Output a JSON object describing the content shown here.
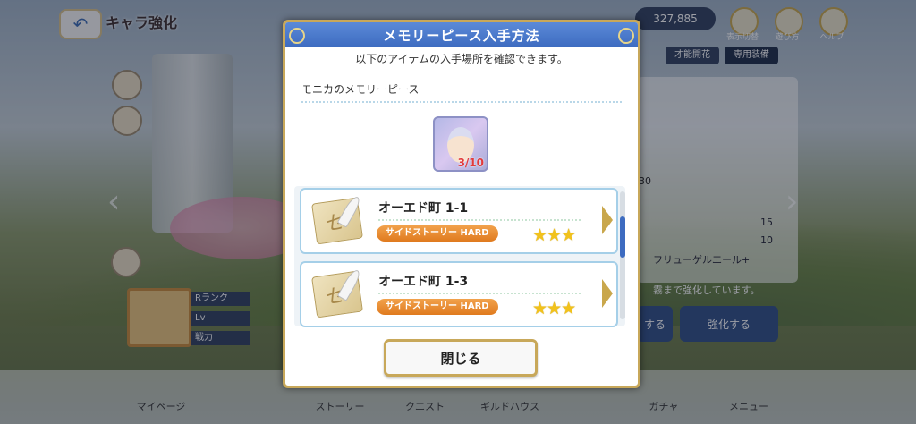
{
  "background": {
    "screen_title": "キャラ強化",
    "mana": "327,885",
    "top_icons": [
      "表示切替",
      "遊び方",
      "ヘルプ"
    ],
    "tabs": [
      "才能開花",
      "専用装備"
    ],
    "stats": [
      {
        "label": "",
        "value": "15"
      },
      {
        "label": "",
        "value": "10"
      },
      {
        "label": "フリューゲルエール+",
        "value": ""
      }
    ],
    "notice": "霧まで強化しています。",
    "side_buttons": [
      "する",
      "強化する"
    ],
    "piece_count_bg": "30",
    "char_labels": [
      "Rランク",
      "Lv",
      "戦力"
    ],
    "nav": [
      "マイページ",
      "ストーリー",
      "クエスト",
      "ギルドハウス",
      "ガチャ",
      "メニュー"
    ]
  },
  "modal": {
    "title": "メモリーピース入手方法",
    "description": "以下のアイテムの入手場所を確認できます。",
    "piece_name": "モニカのメモリーピース",
    "piece_count": "3/10",
    "quests": [
      {
        "name": "オーエド町 1-1",
        "badge": "サイドストーリー HARD",
        "stars": "★★★"
      },
      {
        "name": "オーエド町 1-3",
        "badge": "サイドストーリー HARD",
        "stars": "★★★"
      }
    ],
    "close_label": "閉じる"
  },
  "colors": {
    "header_blue": "#3d6bc0",
    "gold": "#c8a85a",
    "badge_orange": "#e07a1e",
    "star": "#f2c21b"
  }
}
